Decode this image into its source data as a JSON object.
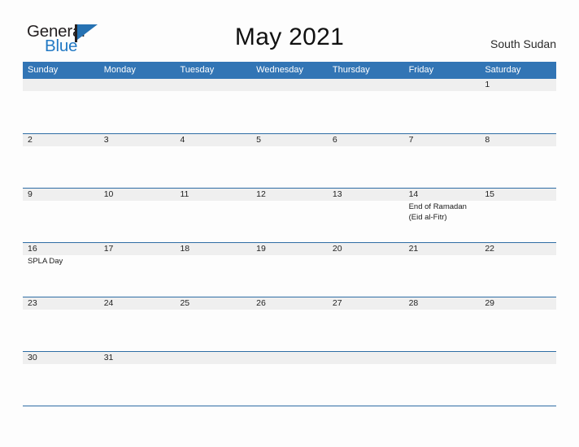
{
  "header": {
    "logo": {
      "primary_text": "General",
      "secondary_text": "Blue",
      "primary_color": "#231f20",
      "secondary_color": "#2279c4",
      "flag_color": "#2672b3"
    },
    "title": "May 2021",
    "country": "South Sudan"
  },
  "colors": {
    "header_blue": "#3275b5",
    "divider_blue": "#2e6da4",
    "daynum_band_gray": "#efefef",
    "page_background": "#fdfdfd",
    "text_dark": "#222222"
  },
  "weekday_headers": [
    "Sunday",
    "Monday",
    "Tuesday",
    "Wednesday",
    "Thursday",
    "Friday",
    "Saturday"
  ],
  "weeks": [
    {
      "days": [
        {
          "date": "",
          "events": []
        },
        {
          "date": "",
          "events": []
        },
        {
          "date": "",
          "events": []
        },
        {
          "date": "",
          "events": []
        },
        {
          "date": "",
          "events": []
        },
        {
          "date": "",
          "events": []
        },
        {
          "date": "1",
          "events": []
        }
      ]
    },
    {
      "days": [
        {
          "date": "2",
          "events": []
        },
        {
          "date": "3",
          "events": []
        },
        {
          "date": "4",
          "events": []
        },
        {
          "date": "5",
          "events": []
        },
        {
          "date": "6",
          "events": []
        },
        {
          "date": "7",
          "events": []
        },
        {
          "date": "8",
          "events": []
        }
      ]
    },
    {
      "days": [
        {
          "date": "9",
          "events": []
        },
        {
          "date": "10",
          "events": []
        },
        {
          "date": "11",
          "events": []
        },
        {
          "date": "12",
          "events": []
        },
        {
          "date": "13",
          "events": []
        },
        {
          "date": "14",
          "events": [
            "End of Ramadan",
            "(Eid al-Fitr)"
          ]
        },
        {
          "date": "15",
          "events": []
        }
      ]
    },
    {
      "days": [
        {
          "date": "16",
          "events": [
            "SPLA Day"
          ]
        },
        {
          "date": "17",
          "events": []
        },
        {
          "date": "18",
          "events": []
        },
        {
          "date": "19",
          "events": []
        },
        {
          "date": "20",
          "events": []
        },
        {
          "date": "21",
          "events": []
        },
        {
          "date": "22",
          "events": []
        }
      ]
    },
    {
      "days": [
        {
          "date": "23",
          "events": []
        },
        {
          "date": "24",
          "events": []
        },
        {
          "date": "25",
          "events": []
        },
        {
          "date": "26",
          "events": []
        },
        {
          "date": "27",
          "events": []
        },
        {
          "date": "28",
          "events": []
        },
        {
          "date": "29",
          "events": []
        }
      ]
    },
    {
      "days": [
        {
          "date": "30",
          "events": []
        },
        {
          "date": "31",
          "events": []
        },
        {
          "date": "",
          "events": []
        },
        {
          "date": "",
          "events": []
        },
        {
          "date": "",
          "events": []
        },
        {
          "date": "",
          "events": []
        },
        {
          "date": "",
          "events": []
        }
      ]
    }
  ]
}
